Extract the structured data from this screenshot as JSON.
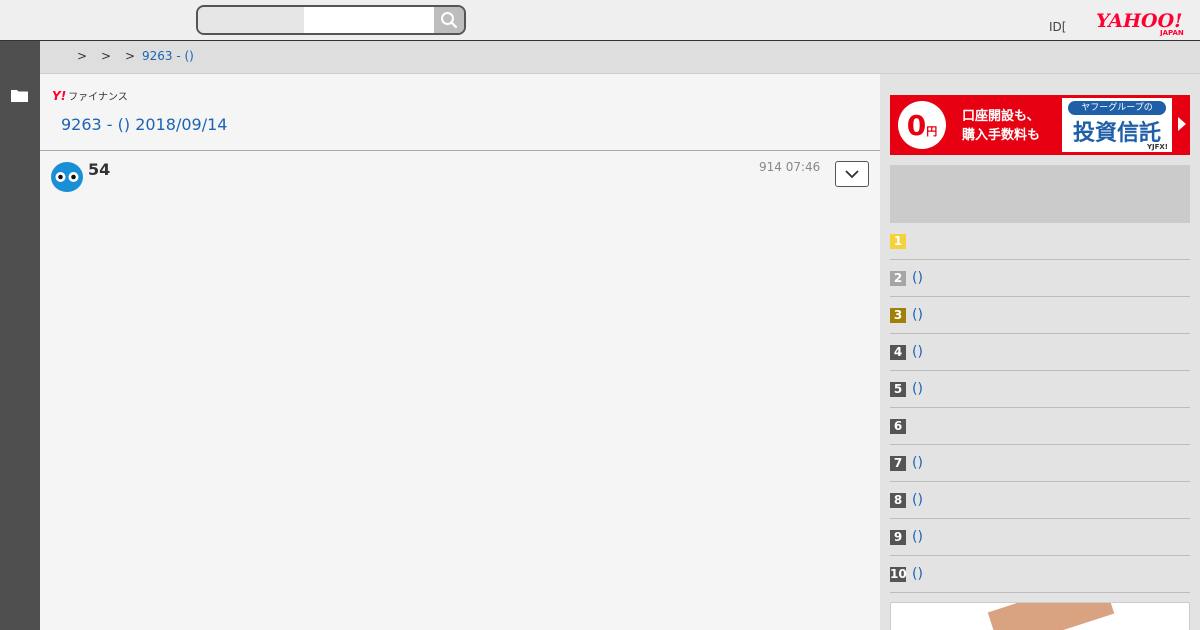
{
  "header": {
    "search_placeholder": "",
    "search_value": "",
    "id_link": "ID[",
    "logo_alt": "YAHOO! JAPAN"
  },
  "breadcrumb": {
    "separators": [
      ">",
      ">",
      ">"
    ],
    "current": "9263 - ()"
  },
  "main": {
    "service_logo": "ファイナンス",
    "page_title": "9263 - () 2018/09/14",
    "post": {
      "number": "54",
      "time": "914 07:46"
    }
  },
  "ad": {
    "zero": "0",
    "yen": "円",
    "line1": "口座開設も、",
    "line2": "購入手数料も",
    "badge": "ヤフーグループの",
    "product": "投資信託",
    "brand": "YJFX!",
    "bg_color": "#e60012"
  },
  "ranking": {
    "items": [
      {
        "rank": "1",
        "label": "",
        "color": "#f5d13b"
      },
      {
        "rank": "2",
        "label": "()",
        "color": "#a6a6a6"
      },
      {
        "rank": "3",
        "label": "()",
        "color": "#a0800b"
      },
      {
        "rank": "4",
        "label": "()",
        "color": "#555555"
      },
      {
        "rank": "5",
        "label": "()",
        "color": "#555555"
      },
      {
        "rank": "6",
        "label": "",
        "color": "#555555"
      },
      {
        "rank": "7",
        "label": "()",
        "color": "#555555"
      },
      {
        "rank": "8",
        "label": "()",
        "color": "#555555"
      },
      {
        "rank": "9",
        "label": "()",
        "color": "#555555"
      },
      {
        "rank": "10",
        "label": "()",
        "color": "#555555"
      }
    ]
  },
  "colors": {
    "link": "#1b64b5",
    "left_rail": "#4f4f4f",
    "yahoo_red": "#ff0033"
  }
}
